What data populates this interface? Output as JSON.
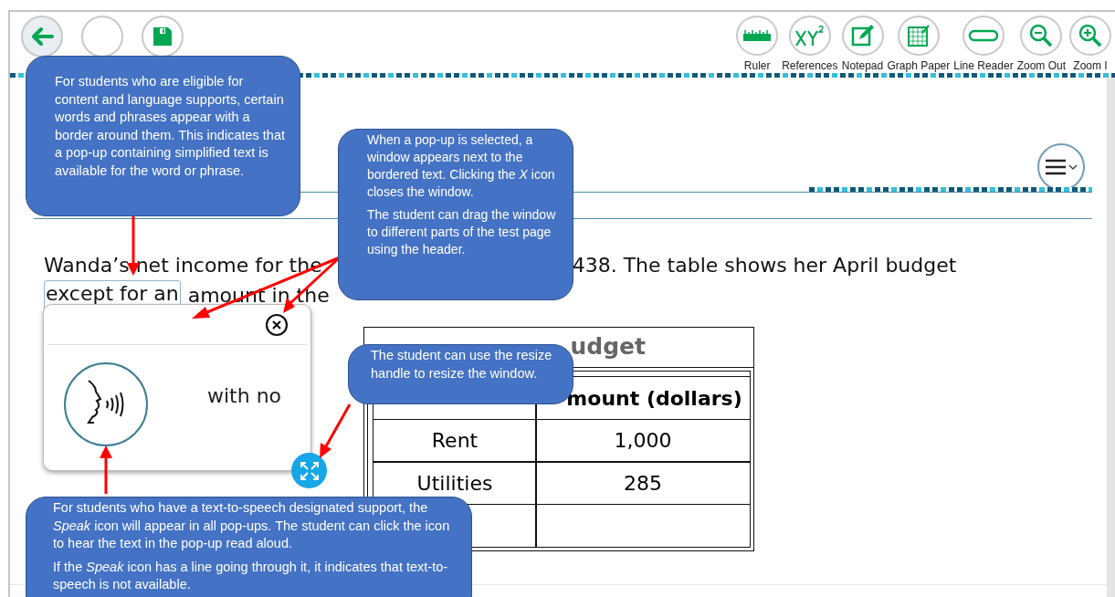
{
  "toolbar": {
    "left_buttons": [
      {
        "kind": "back"
      },
      {
        "kind": "blank"
      },
      {
        "kind": "save"
      }
    ],
    "tools": [
      {
        "label": "Ruler",
        "kind": "ruler"
      },
      {
        "label": "References",
        "kind": "references"
      },
      {
        "label": "Notepad",
        "kind": "notepad"
      },
      {
        "label": "Graph Paper",
        "kind": "graph"
      },
      {
        "label": "Line Reader",
        "kind": "line"
      },
      {
        "label": "Zoom Out",
        "kind": "zoom_out"
      },
      {
        "label": "Zoom I",
        "kind": "zoom_in"
      }
    ]
  },
  "question": {
    "line_1": [
      "Wanda’s net income for the",
      "438. The table shows her April budget"
    ],
    "bordered_phrase": "except for an",
    "line_2_rest": "amount in the"
  },
  "popup": {
    "text": "with no"
  },
  "table": {
    "title": "udget",
    "column_2_heading": "mount (dollars)",
    "rows": [
      [
        "Rent",
        "1,000"
      ],
      [
        "Utilities",
        "285"
      ]
    ]
  },
  "callouts": [
    {
      "paragraphs": [
        "For students who are eligible for content and language supports, certain words and phrases appear with a border around them. This indicates that a pop-up containing simplified text is available for the word or phrase."
      ]
    },
    {
      "paragraphs": [
        "When a pop-up is selected, a window appears next to the bordered text. Clicking the *X* icon closes the window.",
        "The student can drag the window to different parts of the test page using the header."
      ]
    },
    {
      "paragraphs": [
        "The student can use the resize handle to resize the window."
      ]
    },
    {
      "paragraphs": [
        "For students who have a text-to-speech designated support, the *Speak* icon will appear in all pop-ups. The student can click the icon to hear the text in the pop-up read aloud.",
        "If the *Speak* icon has a line going through it, it indicates that text-to-speech is not available."
      ]
    }
  ]
}
